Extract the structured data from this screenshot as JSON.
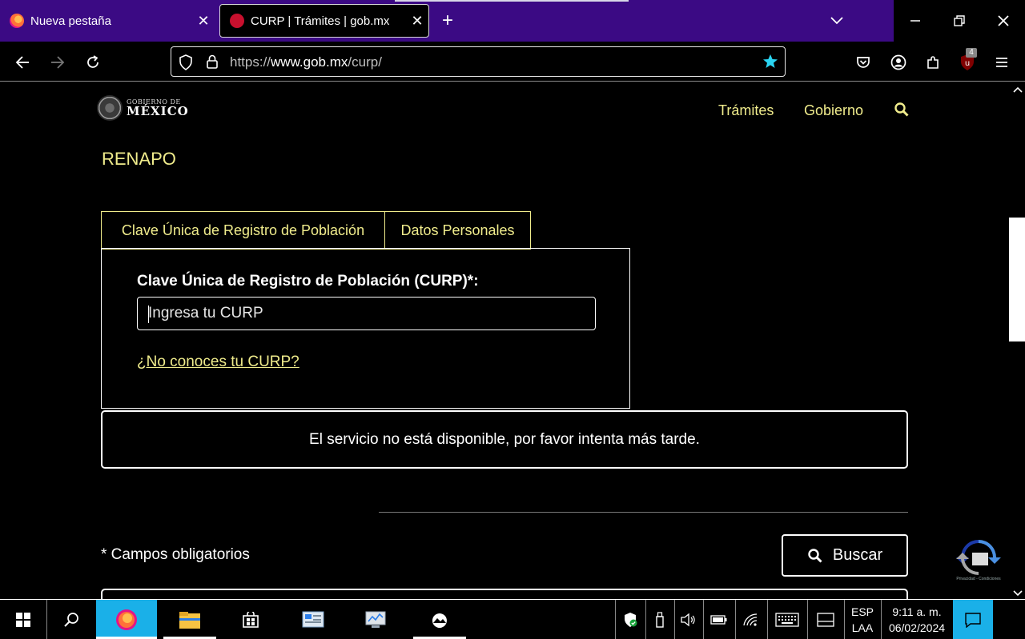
{
  "browser": {
    "tabs": [
      {
        "label": "Nueva pestaña",
        "close": "✕",
        "active": false
      },
      {
        "label": "CURP | Trámites | gob.mx",
        "close": "✕",
        "active": true
      }
    ],
    "new_tab": "+",
    "url": {
      "protocol": "https://",
      "host": "www.gob.mx",
      "path": "/curp/"
    },
    "extension_badge": "4",
    "icons": [
      "back-icon",
      "forward-icon",
      "reload-icon",
      "shield-icon",
      "lock-icon",
      "bookmark-star-icon",
      "pocket-icon",
      "account-icon",
      "extensions-icon",
      "ublock-icon",
      "menu-icon",
      "minimize-icon",
      "restore-icon",
      "close-icon"
    ]
  },
  "site": {
    "logo": {
      "line1": "GOBIERNO DE",
      "line2": "MÉXICO"
    },
    "nav": {
      "tramites": "Trámites",
      "gobierno": "Gobierno"
    },
    "section_title": "RENAPO",
    "tabs": {
      "curp": "Clave Única de Registro de Población",
      "datos": "Datos Personales"
    },
    "form": {
      "label": "Clave Única de Registro de Población (CURP)*:",
      "placeholder": "Ingresa tu CURP",
      "value": "",
      "help_link": "¿No conoces tu CURP?"
    },
    "alert": "El servicio no está disponible, por favor intenta más tarde.",
    "required_note": "* Campos obligatorios",
    "search_button": "Buscar",
    "recaptcha_text": "Privacidad - Condiciones",
    "accent_color": "#f0ec8c"
  },
  "taskbar": {
    "language": {
      "line1": "ESP",
      "line2": "LAA"
    },
    "time": "9:11 a. m.",
    "date": "06/02/2024",
    "accent_color": "#1ab0e8"
  }
}
